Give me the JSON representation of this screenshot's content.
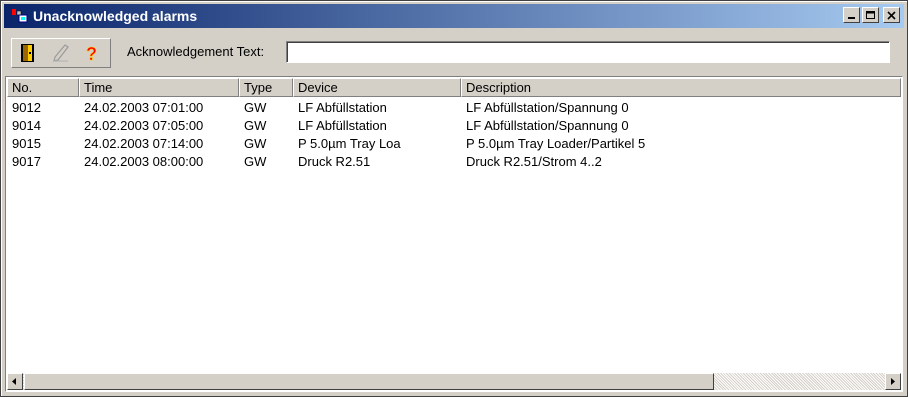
{
  "window": {
    "title": "Unacknowledged alarms",
    "icon": "alarm-app-icon",
    "controls": [
      "minimize-icon",
      "maximize-icon",
      "close-icon"
    ]
  },
  "toolbar": {
    "buttons": [
      "exit-door-icon",
      "pen-icon",
      "help-question-icon"
    ],
    "ack_label": "Acknowledgement Text:",
    "ack_value": ""
  },
  "table": {
    "columns": [
      "No.",
      "Time",
      "Type",
      "Device",
      "Description"
    ],
    "rows": [
      {
        "no": "9012",
        "time": "24.02.2003 07:01:00",
        "type": "GW",
        "device": "LF Abfüllstation",
        "description": "LF Abfüllstation/Spannung 0"
      },
      {
        "no": "9014",
        "time": "24.02.2003 07:05:00",
        "type": "GW",
        "device": "LF Abfüllstation",
        "description": "LF Abfüllstation/Spannung 0"
      },
      {
        "no": "9015",
        "time": "24.02.2003 07:14:00",
        "type": "GW",
        "device": "P 5.0µm Tray Loa",
        "description": "P 5.0µm Tray Loader/Partikel 5"
      },
      {
        "no": "9017",
        "time": "24.02.2003 08:00:00",
        "type": "GW",
        "device": "Druck R2.51",
        "description": "Druck R2.51/Strom 4..2"
      }
    ]
  },
  "colors": {
    "title_start": "#0a246a",
    "title_end": "#a6caf0",
    "face": "#d4d0c8"
  }
}
